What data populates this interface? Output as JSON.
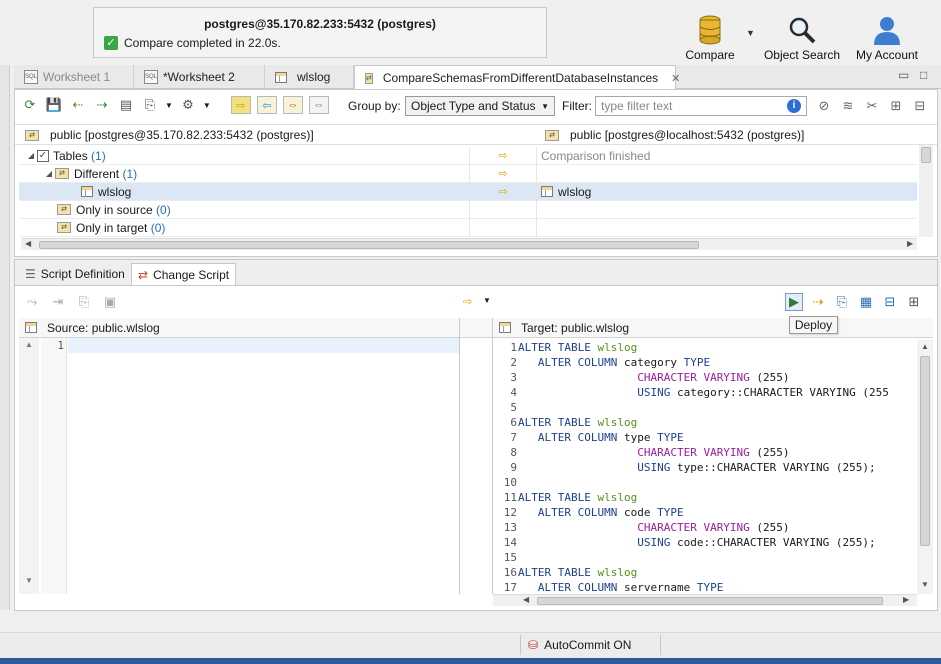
{
  "notification": {
    "title": "postgres@35.170.82.233:5432 (postgres)",
    "message": "Compare completed in 22.0s."
  },
  "top_toolbar": {
    "compare": "Compare",
    "object_search": "Object Search",
    "my_account": "My Account"
  },
  "tabs": [
    {
      "label": "Worksheet 1"
    },
    {
      "label": "*Worksheet 2"
    },
    {
      "label": "wlslog"
    },
    {
      "label": "CompareSchemasFromDifferentDatabaseInstances"
    }
  ],
  "compare_toolbar": {
    "group_by_label": "Group by:",
    "group_by_value": "Object Type and Status",
    "filter_label": "Filter:",
    "filter_placeholder": "type filter text"
  },
  "compare_tree": {
    "source_header": "public [postgres@35.170.82.233:5432 (postgres)]",
    "target_header": "public [postgres@localhost:5432 (postgres)]",
    "rows": [
      {
        "label": "Tables",
        "count": "(1)",
        "target": "Comparison finished"
      },
      {
        "label": "Different",
        "count": "(1)",
        "target": ""
      },
      {
        "label": "wlslog",
        "count": "",
        "target": "wlslog"
      },
      {
        "label": "Only in source",
        "count": "(0)",
        "target": ""
      },
      {
        "label": "Only in target",
        "count": "(0)",
        "target": ""
      }
    ]
  },
  "bottom_tabs": {
    "script_definition": "Script Definition",
    "change_script": "Change Script"
  },
  "tooltip": "Deploy",
  "source_editor": {
    "title": "Source: public.wlslog",
    "line1": "1"
  },
  "target_editor": {
    "title": "Target: public.wlslog",
    "lines": [
      {
        "n": "1",
        "text": "ALTER TABLE wlslog"
      },
      {
        "n": "2",
        "text": "   ALTER COLUMN category TYPE"
      },
      {
        "n": "3",
        "text": "                  CHARACTER VARYING (255)"
      },
      {
        "n": "4",
        "text": "                  USING category::CHARACTER VARYING (255"
      },
      {
        "n": "5",
        "text": ""
      },
      {
        "n": "6",
        "text": "ALTER TABLE wlslog"
      },
      {
        "n": "7",
        "text": "   ALTER COLUMN type TYPE"
      },
      {
        "n": "8",
        "text": "                  CHARACTER VARYING (255)"
      },
      {
        "n": "9",
        "text": "                  USING type::CHARACTER VARYING (255);"
      },
      {
        "n": "10",
        "text": ""
      },
      {
        "n": "11",
        "text": "ALTER TABLE wlslog"
      },
      {
        "n": "12",
        "text": "   ALTER COLUMN code TYPE"
      },
      {
        "n": "13",
        "text": "                  CHARACTER VARYING (255)"
      },
      {
        "n": "14",
        "text": "                  USING code::CHARACTER VARYING (255);"
      },
      {
        "n": "15",
        "text": ""
      },
      {
        "n": "16",
        "text": "ALTER TABLE wlslog"
      },
      {
        "n": "17",
        "text": "   ALTER COLUMN servername TYPE"
      }
    ]
  },
  "statusbar": {
    "autocommit": "AutoCommit ON"
  }
}
